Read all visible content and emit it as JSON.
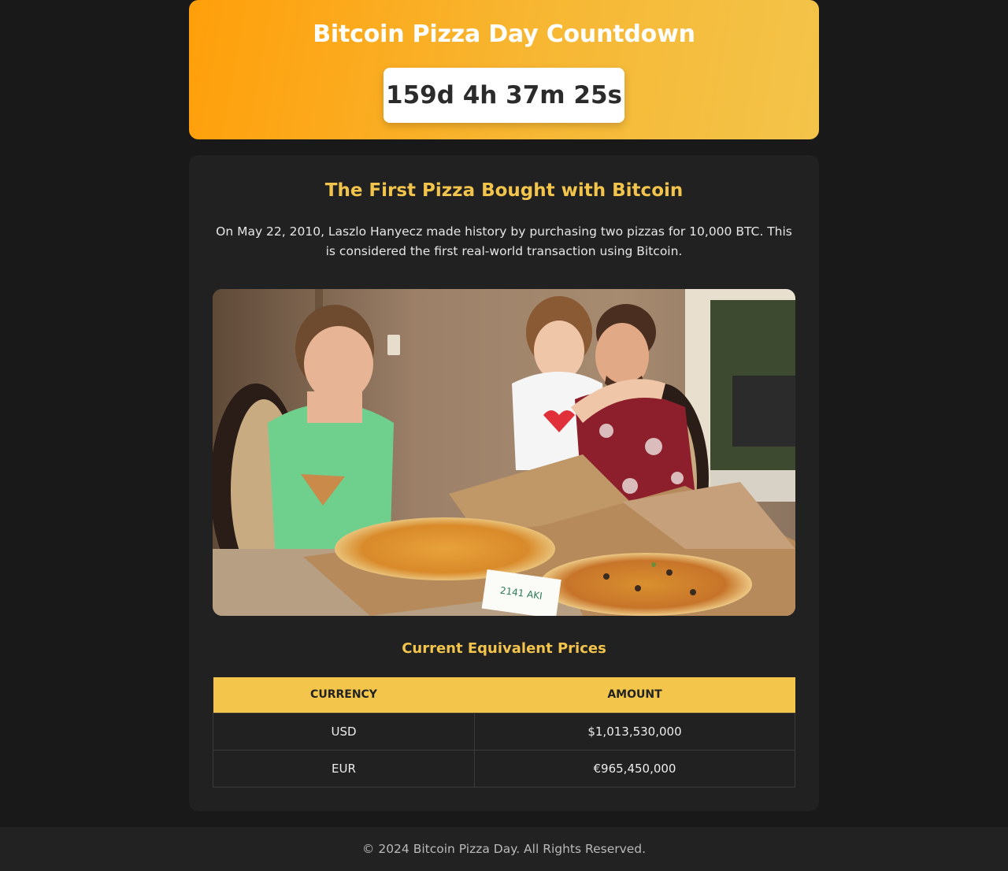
{
  "header": {
    "title": "Bitcoin Pizza Day Countdown",
    "countdown": "159d 4h 37m 25s"
  },
  "story": {
    "title": "The First Pizza Bought with Bitcoin",
    "text": "On May 22, 2010, Laszlo Hanyecz made history by purchasing two pizzas for 10,000 BTC. This is considered the first real-world transaction using Bitcoin.",
    "note_text": "2141 AKI"
  },
  "prices": {
    "title": "Current Equivalent Prices",
    "columns": [
      "Currency",
      "Amount"
    ],
    "rows": [
      {
        "currency": "USD",
        "amount": "$1,013,530,000"
      },
      {
        "currency": "EUR",
        "amount": "€965,450,000"
      }
    ]
  },
  "footer": {
    "text": "© 2024 Bitcoin Pizza Day. All Rights Reserved."
  },
  "colors": {
    "accent": "#f3c64b",
    "hero_start": "#ff9f0a",
    "background": "#19191a",
    "card": "#212121"
  }
}
